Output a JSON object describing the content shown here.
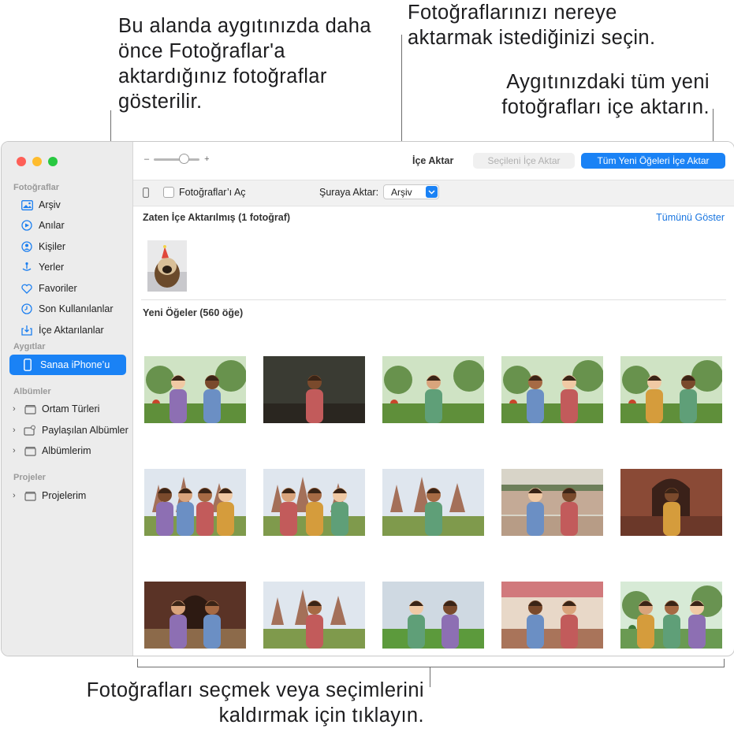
{
  "callouts": {
    "left": "Bu alanda aygıtınızda daha önce Fotoğraflar'a aktardığınız fotoğraflar gösterilir.",
    "top": "Fotoğraflarınızı nereye aktarmak istediğinizi seçin.",
    "right": "Aygıtınızdaki tüm yeni fotoğrafları içe aktarın.",
    "bottom": "Fotoğrafları seçmek veya seçimlerini kaldırmak için tıklayın."
  },
  "sidebar": {
    "sections": {
      "photos": "Fotoğraflar",
      "devices": "Aygıtlar",
      "albums": "Albümler",
      "projects": "Projeler"
    },
    "photo_items": [
      {
        "label": "Arşiv",
        "icon": "library-icon"
      },
      {
        "label": "Anılar",
        "icon": "memories-icon"
      },
      {
        "label": "Kişiler",
        "icon": "people-icon"
      },
      {
        "label": "Yerler",
        "icon": "places-icon"
      },
      {
        "label": "Favoriler",
        "icon": "heart-icon"
      },
      {
        "label": "Son Kullanılanlar",
        "icon": "clock-icon"
      },
      {
        "label": "İçe Aktarılanlar",
        "icon": "import-icon"
      }
    ],
    "device": {
      "label": "Sanaa iPhone’u",
      "icon": "iphone-icon"
    },
    "album_items": [
      {
        "label": "Ortam Türleri",
        "icon": "folder-icon"
      },
      {
        "label": "Paylaşılan Albümler",
        "icon": "shared-album-icon"
      },
      {
        "label": "Albümlerim",
        "icon": "folder-icon"
      }
    ],
    "project_items": [
      {
        "label": "Projelerim",
        "icon": "folder-icon"
      }
    ]
  },
  "toolbar": {
    "zoom_minus": "–",
    "zoom_plus": "+",
    "zoom_level": 0.65,
    "title": "İçe Aktar",
    "import_selected": "Seçileni İçe Aktar",
    "import_all": "Tüm Yeni Öğeleri İçe Aktar"
  },
  "subbar": {
    "open_photos_label": "Fotoğraflar’ı Aç",
    "open_photos_checked": false,
    "destination_label": "Şuraya Aktar:",
    "destination_value": "Arşiv"
  },
  "content": {
    "already_imported_title": "Zaten İçe Aktarılmış (1 fotoğraf)",
    "show_all": "Tümünü Göster",
    "new_items_title": "Yeni Öğeler (560 öğe)"
  },
  "colors": {
    "accent": "#1a82f5",
    "sidebar_bg": "#ececec",
    "link": "#1a76e0"
  },
  "thumbnails": [
    {
      "scene": "garden",
      "people": 2
    },
    {
      "scene": "cafe",
      "people": 1
    },
    {
      "scene": "garden",
      "people": 1
    },
    {
      "scene": "garden",
      "people": 2
    },
    {
      "scene": "garden",
      "people": 2
    },
    {
      "scene": "temple",
      "people": 4
    },
    {
      "scene": "temple",
      "people": 3
    },
    {
      "scene": "temple",
      "people": 1
    },
    {
      "scene": "river",
      "people": 2
    },
    {
      "scene": "brick",
      "people": 1
    },
    {
      "scene": "doorway",
      "people": 2
    },
    {
      "scene": "temple",
      "people": 1
    },
    {
      "scene": "lawn",
      "people": 2
    },
    {
      "scene": "market",
      "people": 2
    },
    {
      "scene": "jungle",
      "people": 3
    }
  ]
}
